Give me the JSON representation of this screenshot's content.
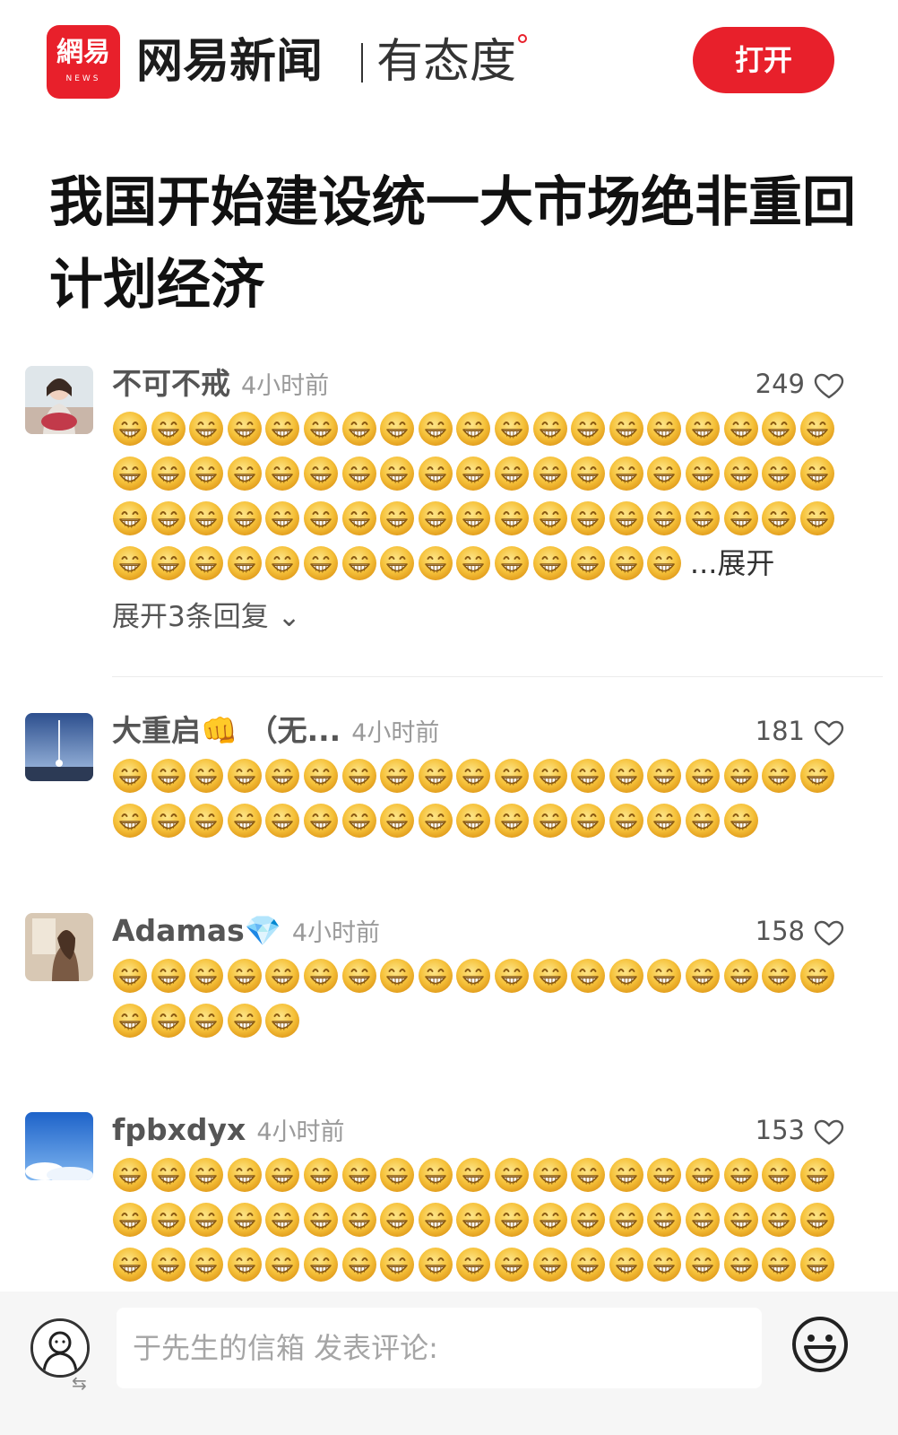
{
  "header": {
    "logo_cn": "網易",
    "logo_en": "NEWS",
    "brand_name": "网易新闻",
    "slogan": "有态度",
    "open_label": "打开"
  },
  "article": {
    "title": "我国开始建设统一大市场绝非重回计划经济"
  },
  "comments": [
    {
      "user": "不可不戒",
      "time": "4小时前",
      "likes": "249",
      "emoji": "grinning-face",
      "emoji_count": 72,
      "expand_label": "...展开",
      "replies_label": "展开3条回复 ⌄"
    },
    {
      "user": "大重启👊 （无...",
      "time": "4小时前",
      "likes": "181",
      "emoji": "grinning-face",
      "emoji_count": 36
    },
    {
      "user": "Adamas💎",
      "time": "4小时前",
      "likes": "158",
      "emoji": "grinning-face",
      "emoji_count": 24
    },
    {
      "user": "fpbxdyx",
      "time": "4小时前",
      "likes": "153",
      "emoji": "grinning-face",
      "emoji_count": 57
    }
  ],
  "bottom_bar": {
    "placeholder": "于先生的信箱 发表评论:",
    "switch_icon": "⇆"
  },
  "colors": {
    "brand_red": "#e8202b",
    "emoji_yellow": "#f6c23b"
  }
}
